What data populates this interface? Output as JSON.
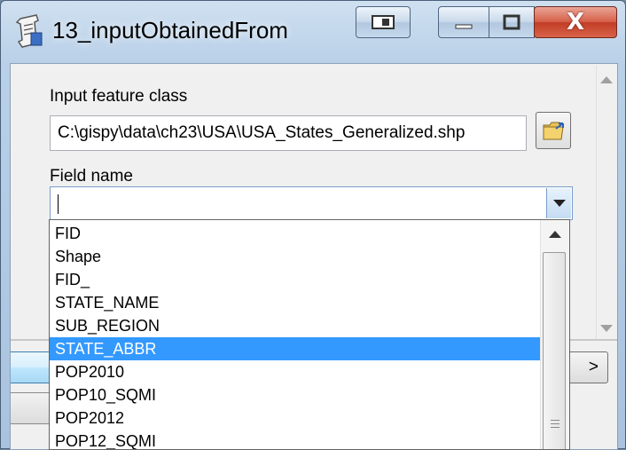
{
  "window": {
    "title": "13_inputObtainedFrom",
    "app_icon": "script-tool-icon",
    "caption_buttons": [
      "window-extra-icon",
      "minimize-icon",
      "maximize-icon",
      "close-icon"
    ],
    "close_glyph": "X"
  },
  "form": {
    "input_label": "Input feature class",
    "input_value": "C:\\gispy\\data\\ch23\\USA\\USA_States_Generalized.shp",
    "browse_icon": "open-folder-icon",
    "field_label": "Field name",
    "field_value": ""
  },
  "dropdown": {
    "items": [
      "FID",
      "Shape",
      "FID_",
      "STATE_NAME",
      "SUB_REGION",
      "STATE_ABBR",
      "POP2010",
      "POP10_SQMI",
      "POP2012",
      "POP12_SQMI"
    ],
    "selected": "STATE_ABBR"
  },
  "buttons": {
    "show_help_label": ">"
  },
  "colors": {
    "selection": "#3399ff",
    "close_button": "#c23d26",
    "title_bar": "#b9d0e8"
  }
}
